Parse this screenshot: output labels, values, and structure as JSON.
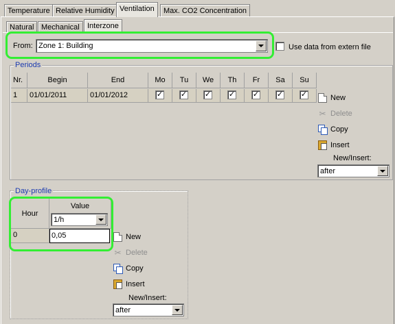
{
  "main_tabs": [
    {
      "label": "Temperature"
    },
    {
      "label": "Relative Humidity"
    },
    {
      "label": "Ventilation"
    },
    {
      "label": "Max. CO2 Concentration"
    }
  ],
  "sub_tabs": [
    {
      "label": "Natural"
    },
    {
      "label": "Mechanical"
    },
    {
      "label": "Interzone"
    }
  ],
  "from": {
    "label": "From:",
    "value": "Zone 1: Building",
    "extern_label": "Use data from extern file",
    "extern_checked": false
  },
  "periods": {
    "title": "Periods",
    "columns": [
      "Nr.",
      "Begin",
      "End",
      "Mo",
      "Tu",
      "We",
      "Th",
      "Fr",
      "Sa",
      "Su"
    ],
    "rows": [
      {
        "nr": "1",
        "begin": "01/01/2011",
        "end": "01/01/2012",
        "days": [
          true,
          true,
          true,
          true,
          true,
          true,
          true
        ]
      }
    ],
    "actions": {
      "new": "New",
      "delete": "Delete",
      "copy": "Copy",
      "insert": "Insert",
      "new_insert_label": "New/Insert:",
      "new_insert_value": "after"
    }
  },
  "day_profile": {
    "title": "Day-profile",
    "hour_header": "Hour",
    "value_header": "Value",
    "unit": "1/h",
    "rows": [
      {
        "hour": "0",
        "value": "0,05"
      }
    ],
    "actions": {
      "new": "New",
      "delete": "Delete",
      "copy": "Copy",
      "insert": "Insert",
      "new_insert_label": "New/Insert:",
      "new_insert_value": "after"
    }
  }
}
